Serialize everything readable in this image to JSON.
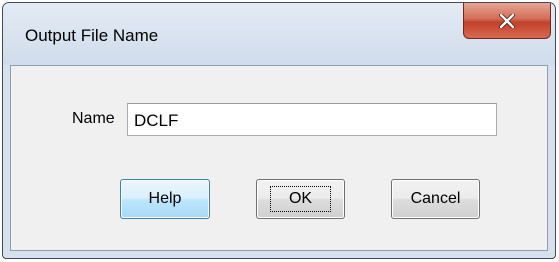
{
  "window": {
    "title": "Output File Name"
  },
  "titlebar": {
    "close_icon": "close-x-icon",
    "close_color": "#c2412b"
  },
  "form": {
    "name_label": "Name",
    "name_value": "DCLF"
  },
  "buttons": {
    "help_label": "Help",
    "ok_label": "OK",
    "cancel_label": "Cancel"
  },
  "colors": {
    "frame": "#d7e1ed",
    "client": "#f0f0f0",
    "help_button": "#bee6fd"
  }
}
